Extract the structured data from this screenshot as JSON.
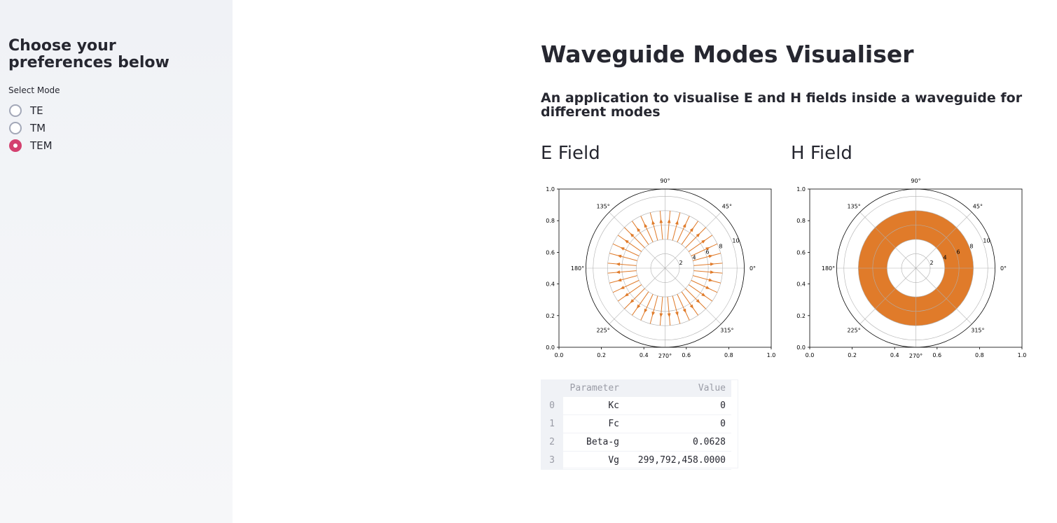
{
  "sidebar": {
    "heading": "Choose your preferences below",
    "mode_label": "Select Mode",
    "options": [
      {
        "label": "TE",
        "checked": false
      },
      {
        "label": "TM",
        "checked": false
      },
      {
        "label": "TEM",
        "checked": true
      }
    ],
    "accent_color": "#d4406f"
  },
  "main": {
    "title": "Waveguide Modes Visualiser",
    "subtitle": "An application to visualise E and H fields inside a waveguide for different modes",
    "e_field_title": "E Field",
    "h_field_title": "H Field"
  },
  "chart_data": [
    {
      "type": "polar",
      "title": "E Field",
      "cartesian_xticks": [
        "0.0",
        "0.2",
        "0.4",
        "0.6",
        "0.8",
        "1.0"
      ],
      "cartesian_yticks": [
        "0.0",
        "0.2",
        "0.4",
        "0.6",
        "0.8",
        "1.0"
      ],
      "angle_ticks": [
        "0°",
        "45°",
        "90°",
        "135°",
        "180°",
        "225°",
        "270°",
        "315°"
      ],
      "radial_ticks": [
        "2",
        "4",
        "6",
        "8",
        "10"
      ],
      "radial_max": 11,
      "field": "radial arrows from r=4 to r=8 at 36 angles",
      "r_inner": 4,
      "r_outer": 8,
      "color": "#e07b2a"
    },
    {
      "type": "polar",
      "title": "H Field",
      "cartesian_xticks": [
        "0.0",
        "0.2",
        "0.4",
        "0.6",
        "0.8",
        "1.0"
      ],
      "cartesian_yticks": [
        "0.0",
        "0.2",
        "0.4",
        "0.6",
        "0.8",
        "1.0"
      ],
      "angle_ticks": [
        "0°",
        "45°",
        "90°",
        "135°",
        "180°",
        "225°",
        "270°",
        "315°"
      ],
      "radial_ticks": [
        "2",
        "4",
        "6",
        "8",
        "10"
      ],
      "radial_max": 11,
      "field": "filled annulus of circular loops",
      "r_inner": 4,
      "r_outer": 8,
      "color": "#e07b2a"
    }
  ],
  "table": {
    "headers": [
      "",
      "Parameter",
      "Value"
    ],
    "rows": [
      {
        "index": "0",
        "parameter": "Kc",
        "value": "0"
      },
      {
        "index": "1",
        "parameter": "Fc",
        "value": "0"
      },
      {
        "index": "2",
        "parameter": "Beta-g",
        "value": "0.0628"
      },
      {
        "index": "3",
        "parameter": "Vg",
        "value": "299,792,458.0000"
      }
    ]
  }
}
